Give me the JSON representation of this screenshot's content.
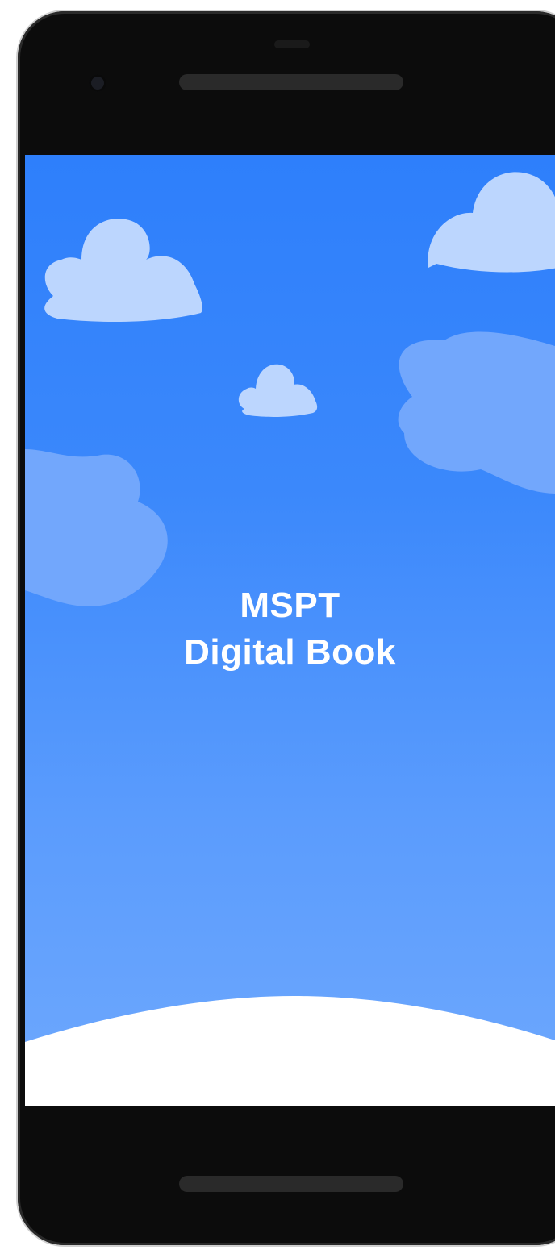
{
  "app": {
    "title_line1": "MSPT",
    "title_line2": "Digital Book"
  },
  "colors": {
    "sky_top": "#2e7ffb",
    "sky_bottom": "#6ea8fd",
    "cloud_light": "#bcd6fe",
    "cloud_mid": "#72a7fc",
    "ground": "#ffffff",
    "device_frame": "#0c0c0c"
  }
}
